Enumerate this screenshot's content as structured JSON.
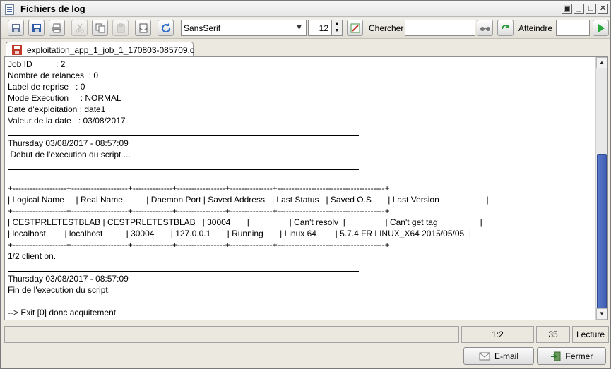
{
  "window": {
    "title": "Fichiers de log",
    "controls": [
      "restore",
      "minimize",
      "maximize",
      "close"
    ]
  },
  "toolbar": {
    "font_family": "SansSerif",
    "font_size": "12",
    "search_label": "Chercher",
    "search_value": "",
    "goto_label": "Atteindre",
    "goto_value": ""
  },
  "tab": {
    "title": "exploitation_app_1_job_1_170803-085709.o"
  },
  "log_lines": [
    "Job ID          : 2",
    "Nombre de relances  : 0",
    "Label de reprise   : 0",
    "Mode Execution     : NORMAL",
    "Date d'exploitation : date1",
    "Valeur de la date   : 03/08/2017",
    "",
    "Thursday 03/08/2017 - 08:57:09",
    " Debut de l'execution du script ...",
    "",
    "",
    "+-------------------+--------------------+--------------+-----------------+---------------+--------------------------------------+",
    "| Logical Name     | Real Name          | Daemon Port | Saved Address   | Last Status   | Saved O.S       | Last Version                    |",
    "+-------------------+--------------------+--------------+-----------------+---------------+--------------------------------------+",
    "| CESTPRLETESTBLAB | CESTPRLETESTBLAB   | 30004       |                 | Can't resolv  |                 | Can't get tag                  |",
    "| localhost        | localhost          | 30004       | 127.0.0.1       | Running       | Linux 64        | 5.7.4 FR LINUX_X64 2015/05/05  |",
    "+-------------------+--------------------+--------------+-----------------+---------------+--------------------------------------+",
    "1/2 client on.",
    "",
    "Thursday 03/08/2017 - 08:57:09",
    "Fin de l'execution du script.",
    "",
    "--> Exit [0] donc acquitement"
  ],
  "status": {
    "message": "",
    "position": "1:2",
    "line_count": "35",
    "mode": "Lecture"
  },
  "buttons": {
    "email": "E-mail",
    "close": "Fermer"
  },
  "colors": {
    "scroll_thumb": "#4566bd",
    "background": "#ece9e1"
  }
}
